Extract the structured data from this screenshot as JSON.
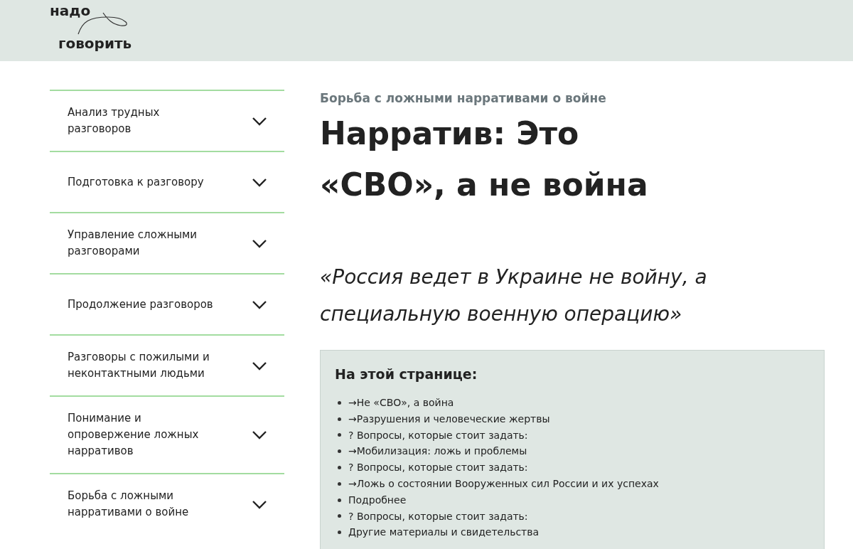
{
  "logo": {
    "line_1": "надо",
    "line_2": "говорить"
  },
  "sidebar": {
    "items": [
      {
        "label": "Анализ трудных разговоров",
        "expanded": false
      },
      {
        "label": "Подготовка к разговору",
        "expanded": false
      },
      {
        "label": "Управление сложными разговорами",
        "expanded": false
      },
      {
        "label": "Продолжение разговоров",
        "expanded": false
      },
      {
        "label": "Разговоры с пожилыми и неконтактными людьми",
        "expanded": false
      },
      {
        "label": "Понимание и опровержение ложных нарративов",
        "expanded": false
      },
      {
        "label": "Борьба с ложными нарративами о войне",
        "expanded": false
      }
    ]
  },
  "breadcrumb": "Борьба с ложными нарративами о войне",
  "title": "Нарратив: Это «СВО», а не война",
  "quote": "«Россия ведет в Украине не войну, а специальную военную операцию»",
  "toc": {
    "heading": "На этой странице:",
    "items": [
      "→Не «СВО», а война",
      "→Разрушения и человеческие жертвы",
      "? Вопросы, которые стоит задать:",
      "→Мобилизация: ложь и проблемы",
      "? Вопросы, которые стоит задать:",
      "→Ложь о состоянии Вооруженных сил России и их успехах",
      "Подробнее",
      "? Вопросы, которые стоит задать:",
      "Другие материалы и свидетельства"
    ]
  }
}
